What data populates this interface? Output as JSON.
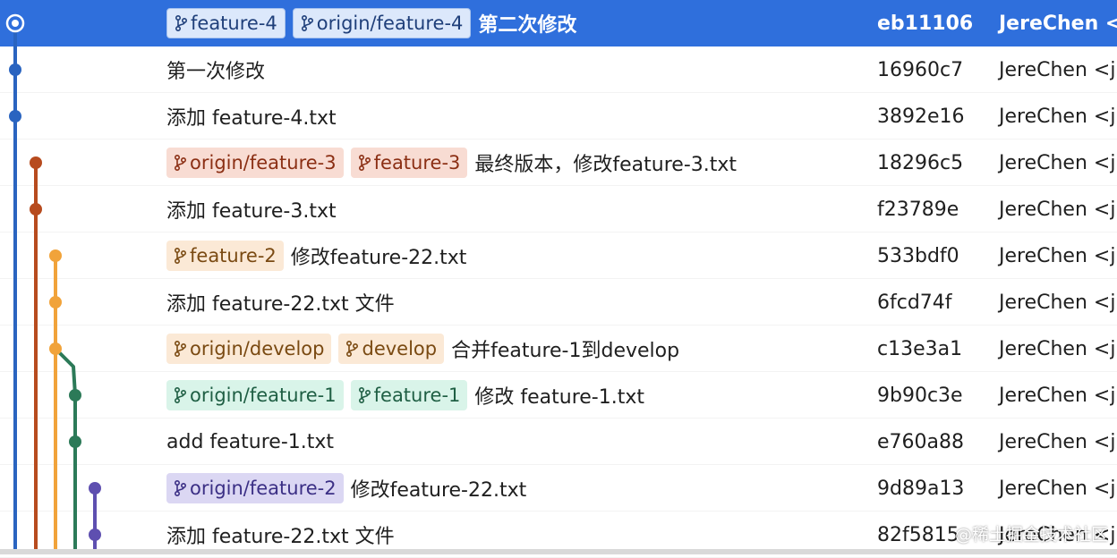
{
  "colors": {
    "selected_bg": "#2f6fdc",
    "lane_blue": "#2a64c0",
    "lane_rust": "#b74b1e",
    "lane_orange": "#f1a33a",
    "lane_green": "#2c7a58",
    "lane_purple": "#5e4fb0"
  },
  "commits": [
    {
      "message": "第二次修改",
      "hash": "eb11106",
      "author": "JereChen <",
      "selected": true,
      "refs": [
        {
          "label": "feature-4",
          "style": "blue-light"
        },
        {
          "label": "origin/feature-4",
          "style": "blue-light"
        }
      ]
    },
    {
      "message": "第一次修改",
      "hash": "16960c7",
      "author": "JereChen <j",
      "refs": []
    },
    {
      "message": "添加 feature-4.txt",
      "hash": "3892e16",
      "author": "JereChen <j",
      "refs": []
    },
    {
      "message": "最终版本，修改feature-3.txt",
      "hash": "18296c5",
      "author": "JereChen <j",
      "refs": [
        {
          "label": "origin/feature-3",
          "style": "red"
        },
        {
          "label": "feature-3",
          "style": "red"
        }
      ]
    },
    {
      "message": "添加 feature-3.txt",
      "hash": "f23789e",
      "author": "JereChen <j",
      "refs": []
    },
    {
      "message": "修改feature-22.txt",
      "hash": "533bdf0",
      "author": "JereChen <j",
      "refs": [
        {
          "label": "feature-2",
          "style": "orange"
        }
      ]
    },
    {
      "message": "添加 feature-22.txt 文件",
      "hash": "6fcd74f",
      "author": "JereChen <j",
      "refs": []
    },
    {
      "message": "合并feature-1到develop",
      "hash": "c13e3a1",
      "author": "JereChen <j",
      "refs": [
        {
          "label": "origin/develop",
          "style": "orange"
        },
        {
          "label": "develop",
          "style": "orange"
        }
      ]
    },
    {
      "message": "修改 feature-1.txt",
      "hash": "9b90c3e",
      "author": "JereChen <j",
      "refs": [
        {
          "label": "origin/feature-1",
          "style": "green"
        },
        {
          "label": "feature-1",
          "style": "green"
        }
      ]
    },
    {
      "message": "add feature-1.txt",
      "hash": "e760a88",
      "author": "JereChen <j",
      "refs": []
    },
    {
      "message": "修改feature-22.txt",
      "hash": "9d89a13",
      "author": "JereChen <j",
      "refs": [
        {
          "label": "origin/feature-2",
          "style": "purple"
        }
      ]
    },
    {
      "message": "添加 feature-22.txt 文件",
      "hash": "82f5815",
      "author": "JereChen <j",
      "refs": []
    }
  ],
  "watermark": "@稀土掘金技术社区"
}
